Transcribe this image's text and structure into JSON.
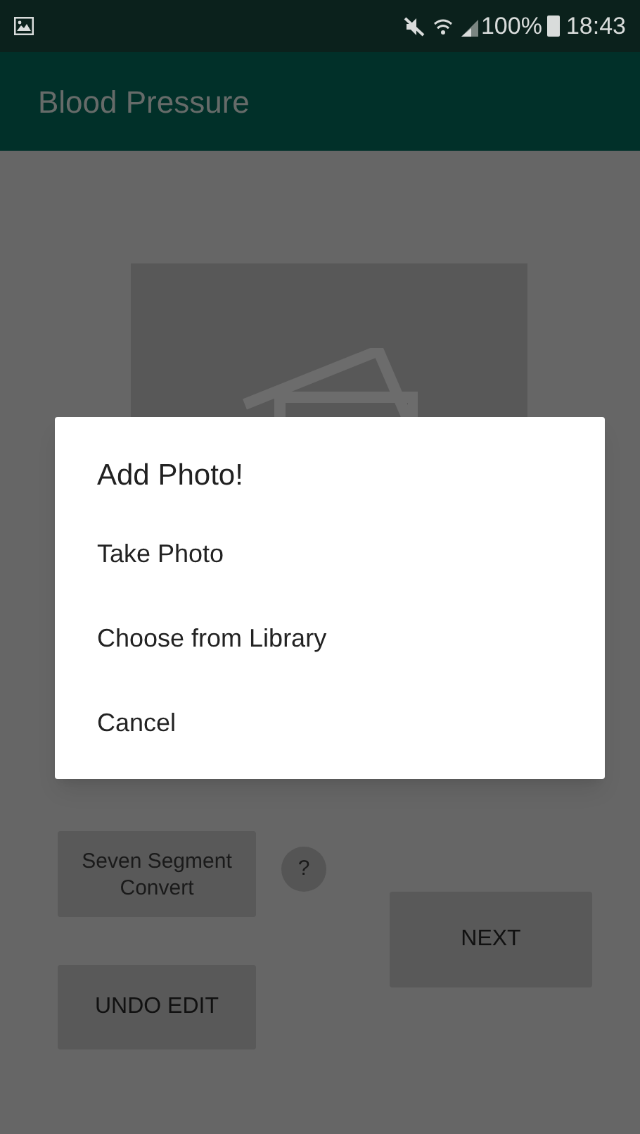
{
  "status_bar": {
    "battery": "100%",
    "time": "18:43"
  },
  "app_bar": {
    "title": "Blood Pressure"
  },
  "buttons": [
    {
      "label": "Seven Segment Convert",
      "kind": "segment"
    },
    {
      "label": "?",
      "kind": "help"
    },
    {
      "label": "NEXT",
      "kind": "next"
    },
    {
      "label": "UNDO EDIT",
      "kind": "undo"
    }
  ],
  "dialog": {
    "title": "Add Photo!",
    "options": [
      "Take Photo",
      "Choose from Library",
      "Cancel"
    ]
  }
}
